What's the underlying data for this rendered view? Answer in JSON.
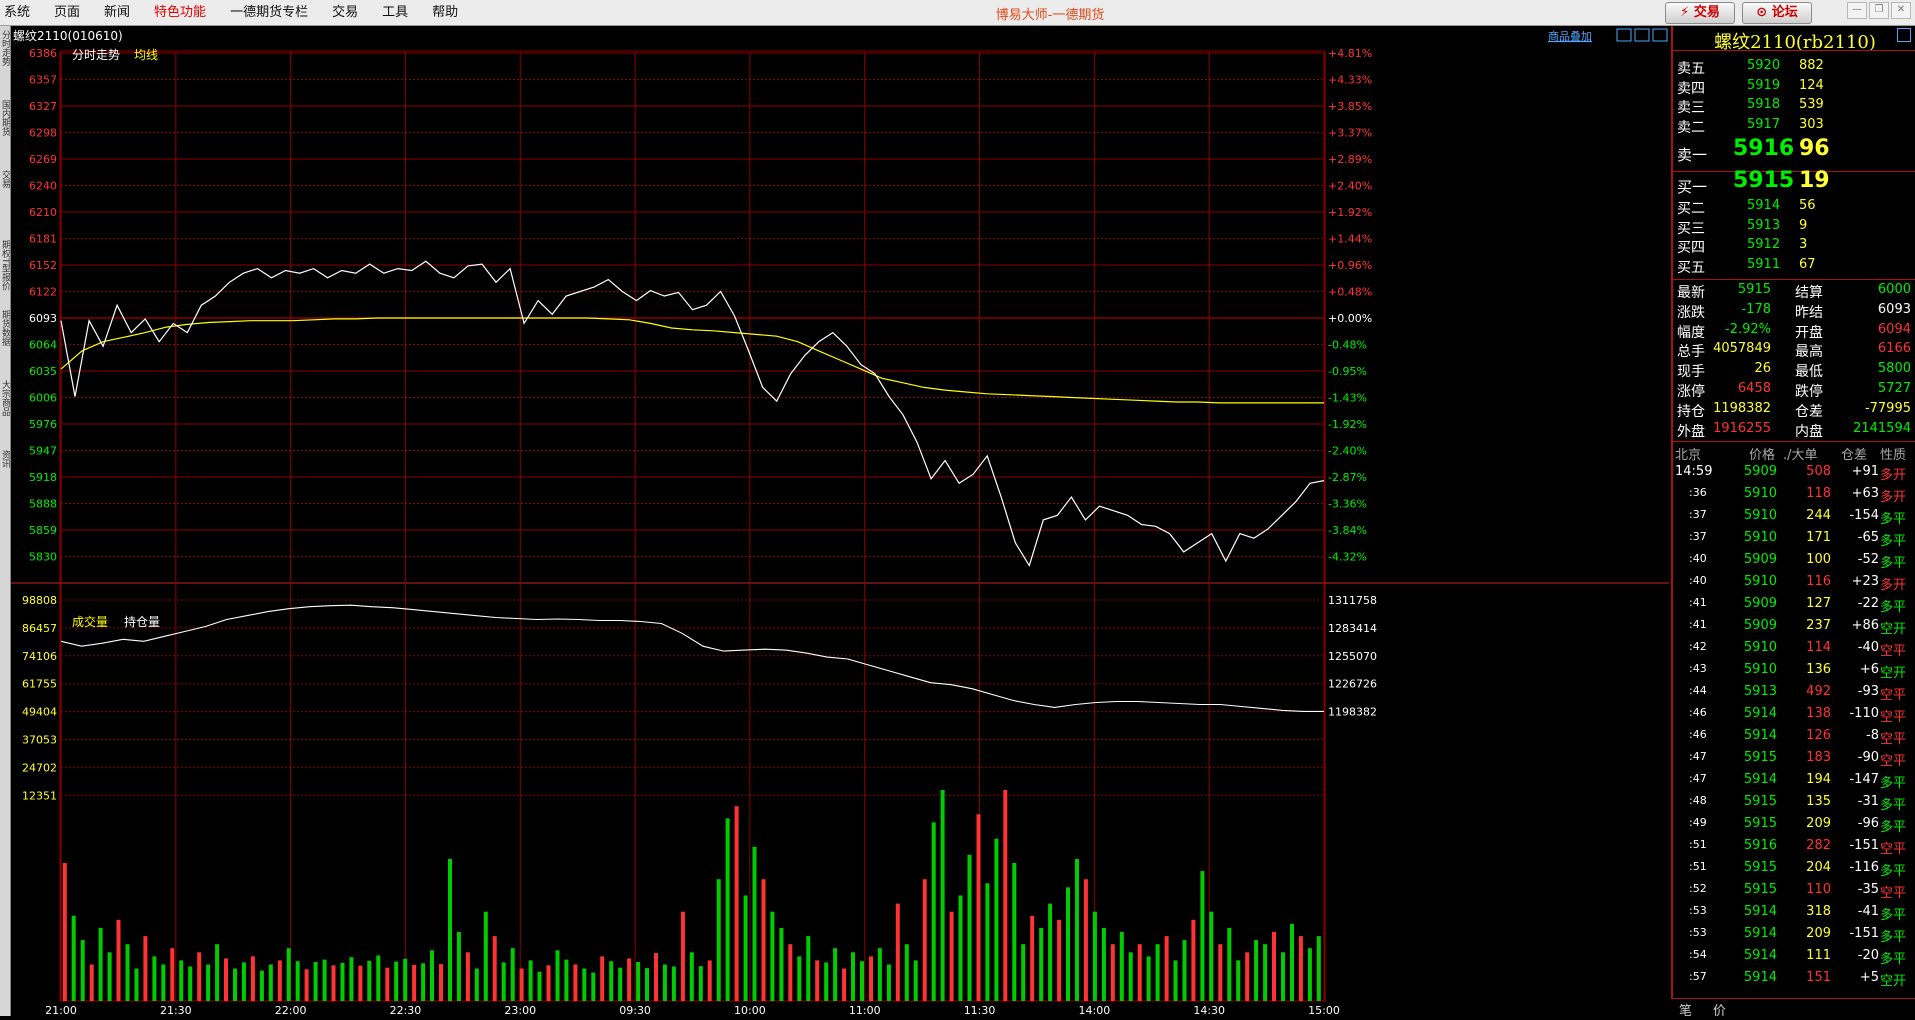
{
  "menubar": {
    "items": [
      {
        "label": "系统",
        "hl": false
      },
      {
        "label": "页面",
        "hl": false
      },
      {
        "label": "新闻",
        "hl": false
      },
      {
        "label": "特色功能",
        "hl": true
      },
      {
        "label": "一德期货专栏",
        "hl": false
      },
      {
        "label": "交易",
        "hl": false
      },
      {
        "label": "工具",
        "hl": false
      },
      {
        "label": "帮助",
        "hl": false
      }
    ],
    "title": "博易大师-一德期货",
    "trade_button": "⚡ 交易",
    "forum_button": "⊙ 论坛"
  },
  "left_tabs": [
    "分时走势",
    "国内期货",
    "交易",
    "期权T型报价",
    "期货数据",
    "大宗商品",
    "资讯"
  ],
  "chart": {
    "instrument": "螺纹2110(010610)",
    "overlay_link": "商品叠加",
    "price_legend": [
      "分时走势",
      "均线"
    ],
    "volume_legend": [
      "成交量",
      "持仓量"
    ],
    "prev_settle": 6093,
    "price_axis": {
      "left": [
        "6386",
        "6357",
        "6327",
        "6298",
        "6269",
        "6240",
        "6210",
        "6181",
        "6152",
        "6122",
        "6093",
        "6064",
        "6035",
        "6006",
        "5976",
        "5947",
        "5918",
        "5888",
        "5859",
        "5830"
      ],
      "right": [
        "+4.81%",
        "+4.33%",
        "+3.85%",
        "+3.37%",
        "+2.89%",
        "+2.40%",
        "+1.92%",
        "+1.44%",
        "+0.96%",
        "+0.48%",
        "+0.00%",
        "-0.48%",
        "-0.95%",
        "-1.43%",
        "-1.92%",
        "-2.40%",
        "-2.87%",
        "-3.36%",
        "-3.84%",
        "-4.32%"
      ]
    },
    "volume_axis": {
      "left": [
        "98808",
        "86457",
        "74106",
        "61755",
        "49404",
        "37053",
        "24702",
        "12351"
      ],
      "right": [
        "1311758",
        "1283414",
        "1255070",
        "1226726",
        "1198382"
      ]
    },
    "time_axis": [
      "21:00",
      "21:30",
      "22:00",
      "22:30",
      "23:00",
      "09:30",
      "10:00",
      "11:00",
      "11:30",
      "14:00",
      "14:30",
      "15:00"
    ],
    "colors": {
      "grid": "#8b0000",
      "price": "#ffffff",
      "avg": "#ffff00",
      "up": "#ff3333",
      "down": "#00cc00",
      "axis_up": "#ff3333",
      "axis_down": "#00ee00"
    }
  },
  "chart_data": [
    {
      "type": "line",
      "title": "分时走势",
      "ylim": [
        5830,
        6386
      ],
      "series": [
        {
          "name": "分时走势",
          "values": [
            6093,
            6010,
            6093,
            6065,
            6110,
            6080,
            6095,
            6070,
            6090,
            6080,
            6110,
            6120,
            6135,
            6145,
            6150,
            6140,
            6148,
            6145,
            6150,
            6140,
            6148,
            6145,
            6155,
            6145,
            6150,
            6148,
            6158,
            6145,
            6140,
            6153,
            6155,
            6135,
            6150,
            6090,
            6115,
            6100,
            6120,
            6125,
            6130,
            6138,
            6125,
            6115,
            6126,
            6120,
            6124,
            6105,
            6110,
            6125,
            6098,
            6060,
            6020,
            6005,
            6035,
            6055,
            6070,
            6080,
            6065,
            6045,
            6035,
            6010,
            5990,
            5960,
            5920,
            5940,
            5915,
            5925,
            5945,
            5900,
            5850,
            5825,
            5875,
            5880,
            5900,
            5875,
            5890,
            5885,
            5880,
            5870,
            5868,
            5860,
            5840,
            5850,
            5860,
            5830,
            5860,
            5855,
            5865,
            5880,
            5895,
            5915,
            5918
          ]
        },
        {
          "name": "均线",
          "values": [
            6040,
            6060,
            6070,
            6075,
            6080,
            6086,
            6089,
            6091,
            6092,
            6093,
            6093,
            6093,
            6094,
            6095,
            6095,
            6096,
            6096,
            6096,
            6096,
            6096,
            6096,
            6096,
            6096,
            6096,
            6096,
            6096,
            6095,
            6094,
            6090,
            6085,
            6083,
            6082,
            6080,
            6078,
            6076,
            6070,
            6060,
            6050,
            6040,
            6030,
            6025,
            6020,
            6017,
            6015,
            6013,
            6012,
            6011,
            6010,
            6009,
            6008,
            6007,
            6006,
            6005,
            6004,
            6004,
            6003,
            6003,
            6003,
            6003,
            6003,
            6003
          ]
        }
      ]
    },
    {
      "type": "bar",
      "title": "成交量",
      "ylim": [
        0,
        98808
      ],
      "values": [
        34000,
        21000,
        15000,
        9000,
        18000,
        12000,
        20000,
        14000,
        8000,
        16000,
        11000,
        9000,
        13000,
        10000,
        8500,
        12000,
        9000,
        14000,
        10500,
        8000,
        9500,
        11000,
        7500,
        9000,
        10000,
        13000,
        9800,
        7800,
        9600,
        10200,
        8800,
        9400,
        10800,
        8700,
        9900,
        11200,
        8200,
        9700,
        10400,
        8900,
        9300,
        12500,
        9100,
        35000,
        17000,
        12000,
        8000,
        22000,
        16000,
        9500,
        13000,
        8000,
        10000,
        7200,
        8800,
        12500,
        10200,
        9000,
        8000,
        7000,
        11000,
        9800,
        8200,
        10500,
        9600,
        8100,
        11800,
        9000,
        8500,
        22000,
        12000,
        8600,
        10000,
        30000,
        45000,
        48000,
        26000,
        38000,
        30000,
        22000,
        18000,
        14000,
        11000,
        16000,
        10000,
        9500,
        13000,
        8000,
        12000,
        9800,
        11000,
        13000,
        9000,
        24000,
        14000,
        10000,
        30000,
        44000,
        52000,
        22000,
        26000,
        36000,
        46000,
        29000,
        40000,
        52000,
        34000,
        14000,
        21000,
        18000,
        24000,
        20000,
        28000,
        35000,
        30000,
        22000,
        18000,
        14000,
        17000,
        12000,
        14000,
        11000,
        14000,
        16000,
        10000,
        15000,
        20000,
        32000,
        22000,
        14000,
        18000,
        10000,
        12000,
        15000,
        14000,
        17000,
        12000,
        19000,
        16000,
        13000,
        16000
      ]
    },
    {
      "type": "line",
      "title": "持仓量",
      "ylim": [
        1198382,
        1311758
      ],
      "values": [
        1270000,
        1265000,
        1268000,
        1272000,
        1270000,
        1275000,
        1280000,
        1285000,
        1292000,
        1296000,
        1300000,
        1303000,
        1305000,
        1306000,
        1306500,
        1305000,
        1304000,
        1302000,
        1300000,
        1298000,
        1296000,
        1294000,
        1293000,
        1292000,
        1292500,
        1292000,
        1291000,
        1291000,
        1290000,
        1288000,
        1278000,
        1265000,
        1260000,
        1261000,
        1262000,
        1261000,
        1258000,
        1254000,
        1252000,
        1246000,
        1240000,
        1234000,
        1228000,
        1226000,
        1222000,
        1216000,
        1210000,
        1206000,
        1203000,
        1206000,
        1208000,
        1209000,
        1209000,
        1208000,
        1207000,
        1206000,
        1206000,
        1204000,
        1202000,
        1200000,
        1199000,
        1199000
      ]
    }
  ],
  "quote": {
    "title": "螺纹2110(rb2110)",
    "asks": [
      {
        "label": "卖五",
        "price": "5920",
        "vol": "882"
      },
      {
        "label": "卖四",
        "price": "5919",
        "vol": "124"
      },
      {
        "label": "卖三",
        "price": "5918",
        "vol": "539"
      },
      {
        "label": "卖二",
        "price": "5917",
        "vol": "303"
      }
    ],
    "ask1": {
      "label": "卖一",
      "price": "5916",
      "vol": "96"
    },
    "bid1": {
      "label": "买一",
      "price": "5915",
      "vol": "19"
    },
    "bids": [
      {
        "label": "买二",
        "price": "5914",
        "vol": "56"
      },
      {
        "label": "买三",
        "price": "5913",
        "vol": "9"
      },
      {
        "label": "买四",
        "price": "5912",
        "vol": "3"
      },
      {
        "label": "买五",
        "price": "5911",
        "vol": "67"
      }
    ],
    "stats": [
      {
        "l1": "最新",
        "v1": "5915",
        "c1": "#00ee00",
        "l2": "结算",
        "v2": "6000",
        "c2": "#00ee00"
      },
      {
        "l1": "涨跌",
        "v1": "-178",
        "c1": "#00ee00",
        "l2": "昨结",
        "v2": "6093",
        "c2": "#ffffff"
      },
      {
        "l1": "幅度",
        "v1": "-2.92%",
        "c1": "#00ee00",
        "l2": "开盘",
        "v2": "6094",
        "c2": "#ff3333"
      },
      {
        "l1": "总手",
        "v1": "4057849",
        "c1": "#ffff33",
        "l2": "最高",
        "v2": "6166",
        "c2": "#ff3333"
      },
      {
        "l1": "现手",
        "v1": "26",
        "c1": "#ffff33",
        "l2": "最低",
        "v2": "5800",
        "c2": "#00ee00"
      },
      {
        "l1": "涨停",
        "v1": "6458",
        "c1": "#ff3333",
        "l2": "跌停",
        "v2": "5727",
        "c2": "#00ee00"
      },
      {
        "l1": "持仓",
        "v1": "1198382",
        "c1": "#ffff33",
        "l2": "仓差",
        "v2": "-77995",
        "c2": "#ffff33"
      },
      {
        "l1": "外盘",
        "v1": "1916255",
        "c1": "#ff3333",
        "l2": "内盘",
        "v2": "2141594",
        "c2": "#00ee00"
      }
    ],
    "ticks_header": [
      "北京",
      "价格",
      "./大单",
      "仓差",
      "性质"
    ],
    "ticks": [
      {
        "t": "14:59",
        "p": "5909",
        "v": "508",
        "vc": "#ff3333",
        "d": "+91",
        "n": "多开",
        "nc": "#ff3333"
      },
      {
        "t": ":36",
        "p": "5910",
        "v": "118",
        "vc": "#ff3333",
        "d": "+63",
        "n": "多开",
        "nc": "#ff3333"
      },
      {
        "t": ":37",
        "p": "5910",
        "v": "244",
        "vc": "#ffff33",
        "d": "-154",
        "n": "多平",
        "nc": "#00ee00"
      },
      {
        "t": ":37",
        "p": "5910",
        "v": "171",
        "vc": "#ffff33",
        "d": "-65",
        "n": "多平",
        "nc": "#00ee00"
      },
      {
        "t": ":40",
        "p": "5909",
        "v": "100",
        "vc": "#ffff33",
        "d": "-52",
        "n": "多平",
        "nc": "#00ee00"
      },
      {
        "t": ":40",
        "p": "5910",
        "v": "116",
        "vc": "#ff3333",
        "d": "+23",
        "n": "多开",
        "nc": "#ff3333"
      },
      {
        "t": ":41",
        "p": "5909",
        "v": "127",
        "vc": "#ffff33",
        "d": "-22",
        "n": "多平",
        "nc": "#00ee00"
      },
      {
        "t": ":41",
        "p": "5909",
        "v": "237",
        "vc": "#ffff33",
        "d": "+86",
        "n": "空开",
        "nc": "#00ee00"
      },
      {
        "t": ":42",
        "p": "5910",
        "v": "114",
        "vc": "#ff3333",
        "d": "-40",
        "n": "空平",
        "nc": "#ff3333"
      },
      {
        "t": ":43",
        "p": "5910",
        "v": "136",
        "vc": "#ffff33",
        "d": "+6",
        "n": "空开",
        "nc": "#00ee00"
      },
      {
        "t": ":44",
        "p": "5913",
        "v": "492",
        "vc": "#ff3333",
        "d": "-93",
        "n": "空平",
        "nc": "#ff3333"
      },
      {
        "t": ":46",
        "p": "5914",
        "v": "138",
        "vc": "#ff3333",
        "d": "-110",
        "n": "空平",
        "nc": "#ff3333"
      },
      {
        "t": ":46",
        "p": "5914",
        "v": "126",
        "vc": "#ff3333",
        "d": "-8",
        "n": "空平",
        "nc": "#ff3333"
      },
      {
        "t": ":47",
        "p": "5915",
        "v": "183",
        "vc": "#ff3333",
        "d": "-90",
        "n": "空平",
        "nc": "#ff3333"
      },
      {
        "t": ":47",
        "p": "5914",
        "v": "194",
        "vc": "#ffff33",
        "d": "-147",
        "n": "多平",
        "nc": "#00ee00"
      },
      {
        "t": ":48",
        "p": "5915",
        "v": "135",
        "vc": "#ffff33",
        "d": "-31",
        "n": "多平",
        "nc": "#00ee00"
      },
      {
        "t": ":49",
        "p": "5915",
        "v": "209",
        "vc": "#ffff33",
        "d": "-96",
        "n": "多平",
        "nc": "#00ee00"
      },
      {
        "t": ":51",
        "p": "5916",
        "v": "282",
        "vc": "#ff3333",
        "d": "-151",
        "n": "空平",
        "nc": "#ff3333"
      },
      {
        "t": ":51",
        "p": "5915",
        "v": "204",
        "vc": "#ffff33",
        "d": "-116",
        "n": "多平",
        "nc": "#00ee00"
      },
      {
        "t": ":52",
        "p": "5915",
        "v": "110",
        "vc": "#ff3333",
        "d": "-35",
        "n": "空平",
        "nc": "#ff3333"
      },
      {
        "t": ":53",
        "p": "5914",
        "v": "318",
        "vc": "#ffff33",
        "d": "-41",
        "n": "多平",
        "nc": "#00ee00"
      },
      {
        "t": ":53",
        "p": "5914",
        "v": "209",
        "vc": "#ffff33",
        "d": "-151",
        "n": "多平",
        "nc": "#00ee00"
      },
      {
        "t": ":54",
        "p": "5914",
        "v": "111",
        "vc": "#ffff33",
        "d": "-20",
        "n": "多平",
        "nc": "#00ee00"
      },
      {
        "t": ":57",
        "p": "5914",
        "v": "151",
        "vc": "#ff3333",
        "d": "+5",
        "n": "空开",
        "nc": "#00ee00"
      }
    ],
    "bottom_tabs": [
      "笔",
      "价"
    ]
  }
}
